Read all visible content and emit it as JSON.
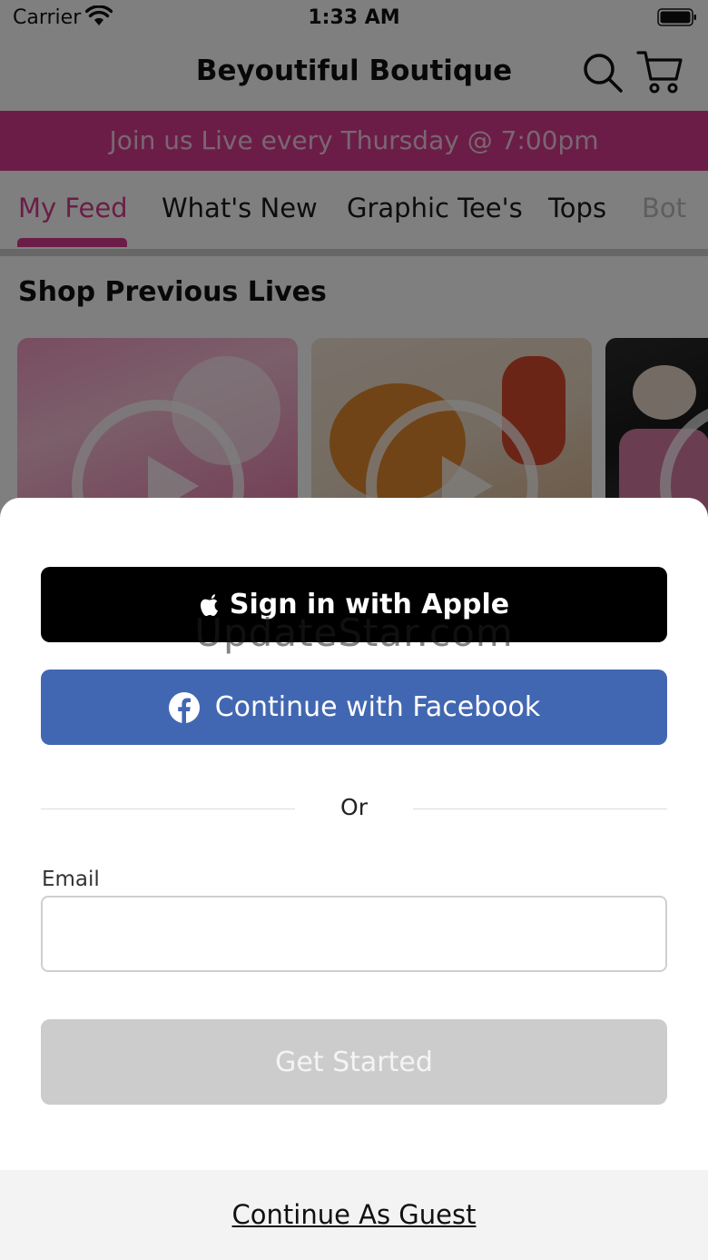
{
  "status_bar": {
    "carrier": "Carrier",
    "time": "1:33 AM"
  },
  "header": {
    "title": "Beyoutiful Boutique",
    "icons": [
      "search-icon",
      "cart-icon"
    ]
  },
  "promo_banner": {
    "text": "Join us Live every Thursday @ 7:00pm",
    "background": "#d63a8e"
  },
  "tabs": [
    {
      "label": "My Feed",
      "active": true
    },
    {
      "label": "What's New",
      "active": false
    },
    {
      "label": "Graphic Tee's",
      "active": false
    },
    {
      "label": "Tops",
      "active": false
    },
    {
      "label": "Bot",
      "active": false
    }
  ],
  "section": {
    "title": "Shop Previous Lives"
  },
  "auth_sheet": {
    "apple_button": "Sign in with Apple",
    "facebook_button": "Continue with Facebook",
    "watermark": "UpdateStar.com",
    "divider_text": "Or",
    "email": {
      "label": "Email",
      "value": "",
      "placeholder": ""
    },
    "submit_button": "Get Started",
    "guest_link": "Continue As Guest"
  },
  "colors": {
    "accent": "#d63a8e",
    "facebook": "#4267b2",
    "apple": "#000000",
    "disabled_button": "#cccccc"
  }
}
